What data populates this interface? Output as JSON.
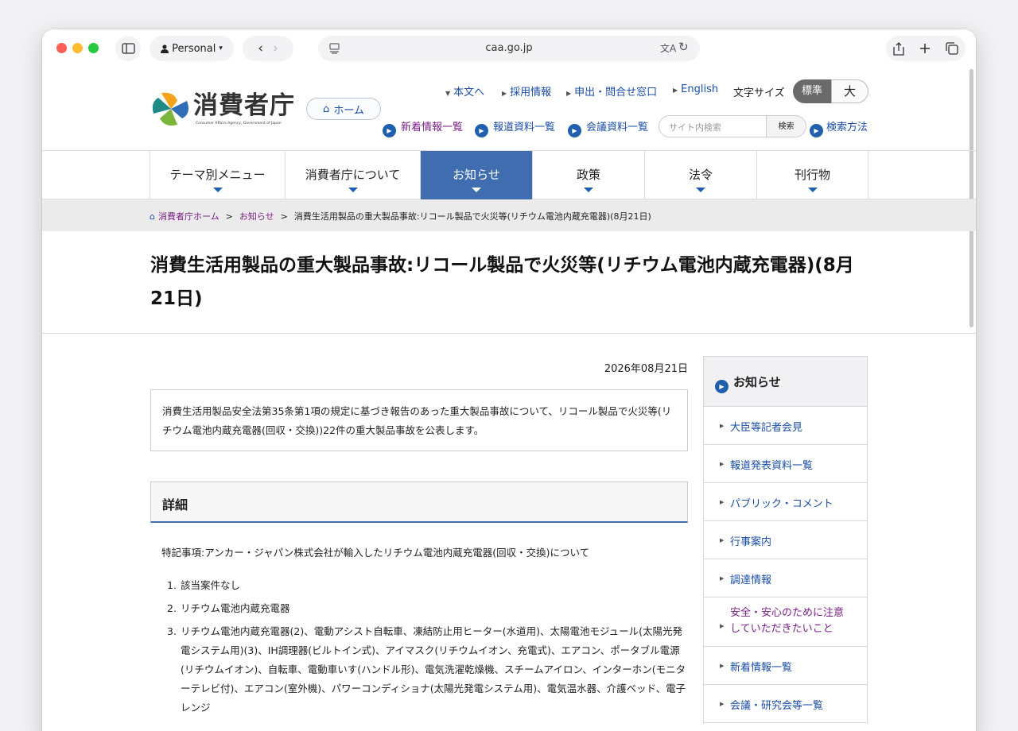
{
  "browser": {
    "profile_label": "Personal",
    "url": "caa.go.jp"
  },
  "header": {
    "logo_text": "消費者庁",
    "logo_subtext": "Consumer Affairs Agency, Government of Japan",
    "home_button": "ホーム",
    "top_links": [
      "本文へ",
      "採用情報",
      "申出・問合せ窓口",
      "English"
    ],
    "font_size_label": "文字サイズ",
    "font_size_standard": "標準",
    "font_size_large": "大",
    "sub_links": [
      "新着情報一覧",
      "報道資料一覧",
      "会議資料一覧"
    ],
    "search_placeholder": "サイト内検索",
    "search_button": "検索",
    "search_method": "検索方法"
  },
  "nav": [
    "テーマ別メニュー",
    "消費者庁について",
    "お知らせ",
    "政策",
    "法令",
    "刊行物"
  ],
  "breadcrumb": {
    "home": "消費者庁ホーム",
    "level1": "お知らせ",
    "current": "消費生活用製品の重大製品事故:リコール製品で火災等(リチウム電池内蔵充電器)(8月21日)"
  },
  "article": {
    "title": "消費生活用製品の重大製品事故:リコール製品で火災等(リチウム電池内蔵充電器)(8月21日)",
    "date": "2026年08月21日",
    "summary": "消費生活用製品安全法第35条第1項の規定に基づき報告のあった重大製品事故について、リコール製品で火災等(リチウム電池内蔵充電器(回収・交換))22件の重大製品事故を公表します。",
    "detail_heading": "詳細",
    "note": "特記事項:アンカー・ジャパン株式会社が輸入したリチウム電池内蔵充電器(回収・交換)について",
    "items": [
      "該当案件なし",
      "リチウム電池内蔵充電器",
      "リチウム電池内蔵充電器(2)、電動アシスト自転車、凍結防止用ヒーター(水道用)、太陽電池モジュール(太陽光発電システム用)(3)、IH調理器(ビルトイン式)、アイマスク(リチウムイオン、充電式)、エアコン、ポータブル電源(リチウムイオン)、自転車、電動車いす(ハンドル形)、電気洗濯乾燥機、スチームアイロン、インターホン(モニターテレビ付)、エアコン(室外機)、パワーコンディショナ(太陽光発電システム用)、電気温水器、介護ベッド、電子レンジ"
    ]
  },
  "sidebar": {
    "heading": "お知らせ",
    "items": [
      "大臣等記者会見",
      "報道発表資料一覧",
      "パブリック・コメント",
      "行事案内",
      "調達情報",
      "安全・安心のために注意していただきたいこと",
      "新着情報一覧",
      "会議・研究会等一覧"
    ]
  },
  "colors": {
    "nav_active": "#3f6db0",
    "link": "#1a4ea8",
    "visited_link": "#7a1f86"
  }
}
